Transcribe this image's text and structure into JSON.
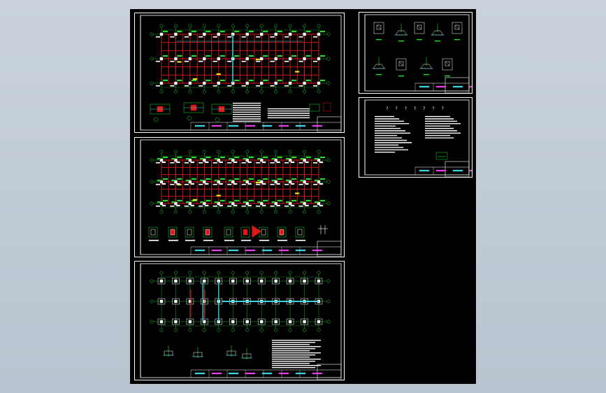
{
  "app": {
    "background": "#c3ccd6",
    "canvas_color": "#000000"
  },
  "colors": {
    "frame": "#ffffff",
    "grid_green": "#22dd33",
    "beam_red": "#e01818",
    "cyan": "#40d0e0",
    "yellow": "#f0e020",
    "magenta": "#e040e0"
  },
  "sheets": [
    {
      "id": "sheet-1",
      "type": "beam-plan"
    },
    {
      "id": "sheet-2",
      "type": "column-plan"
    },
    {
      "id": "sheet-3",
      "type": "foundation-plan"
    },
    {
      "id": "sheet-4",
      "type": "foundation-details"
    },
    {
      "id": "sheet-5",
      "type": "general-notes"
    }
  ],
  "notes_heading": "? ? ? ? ? ? ?"
}
